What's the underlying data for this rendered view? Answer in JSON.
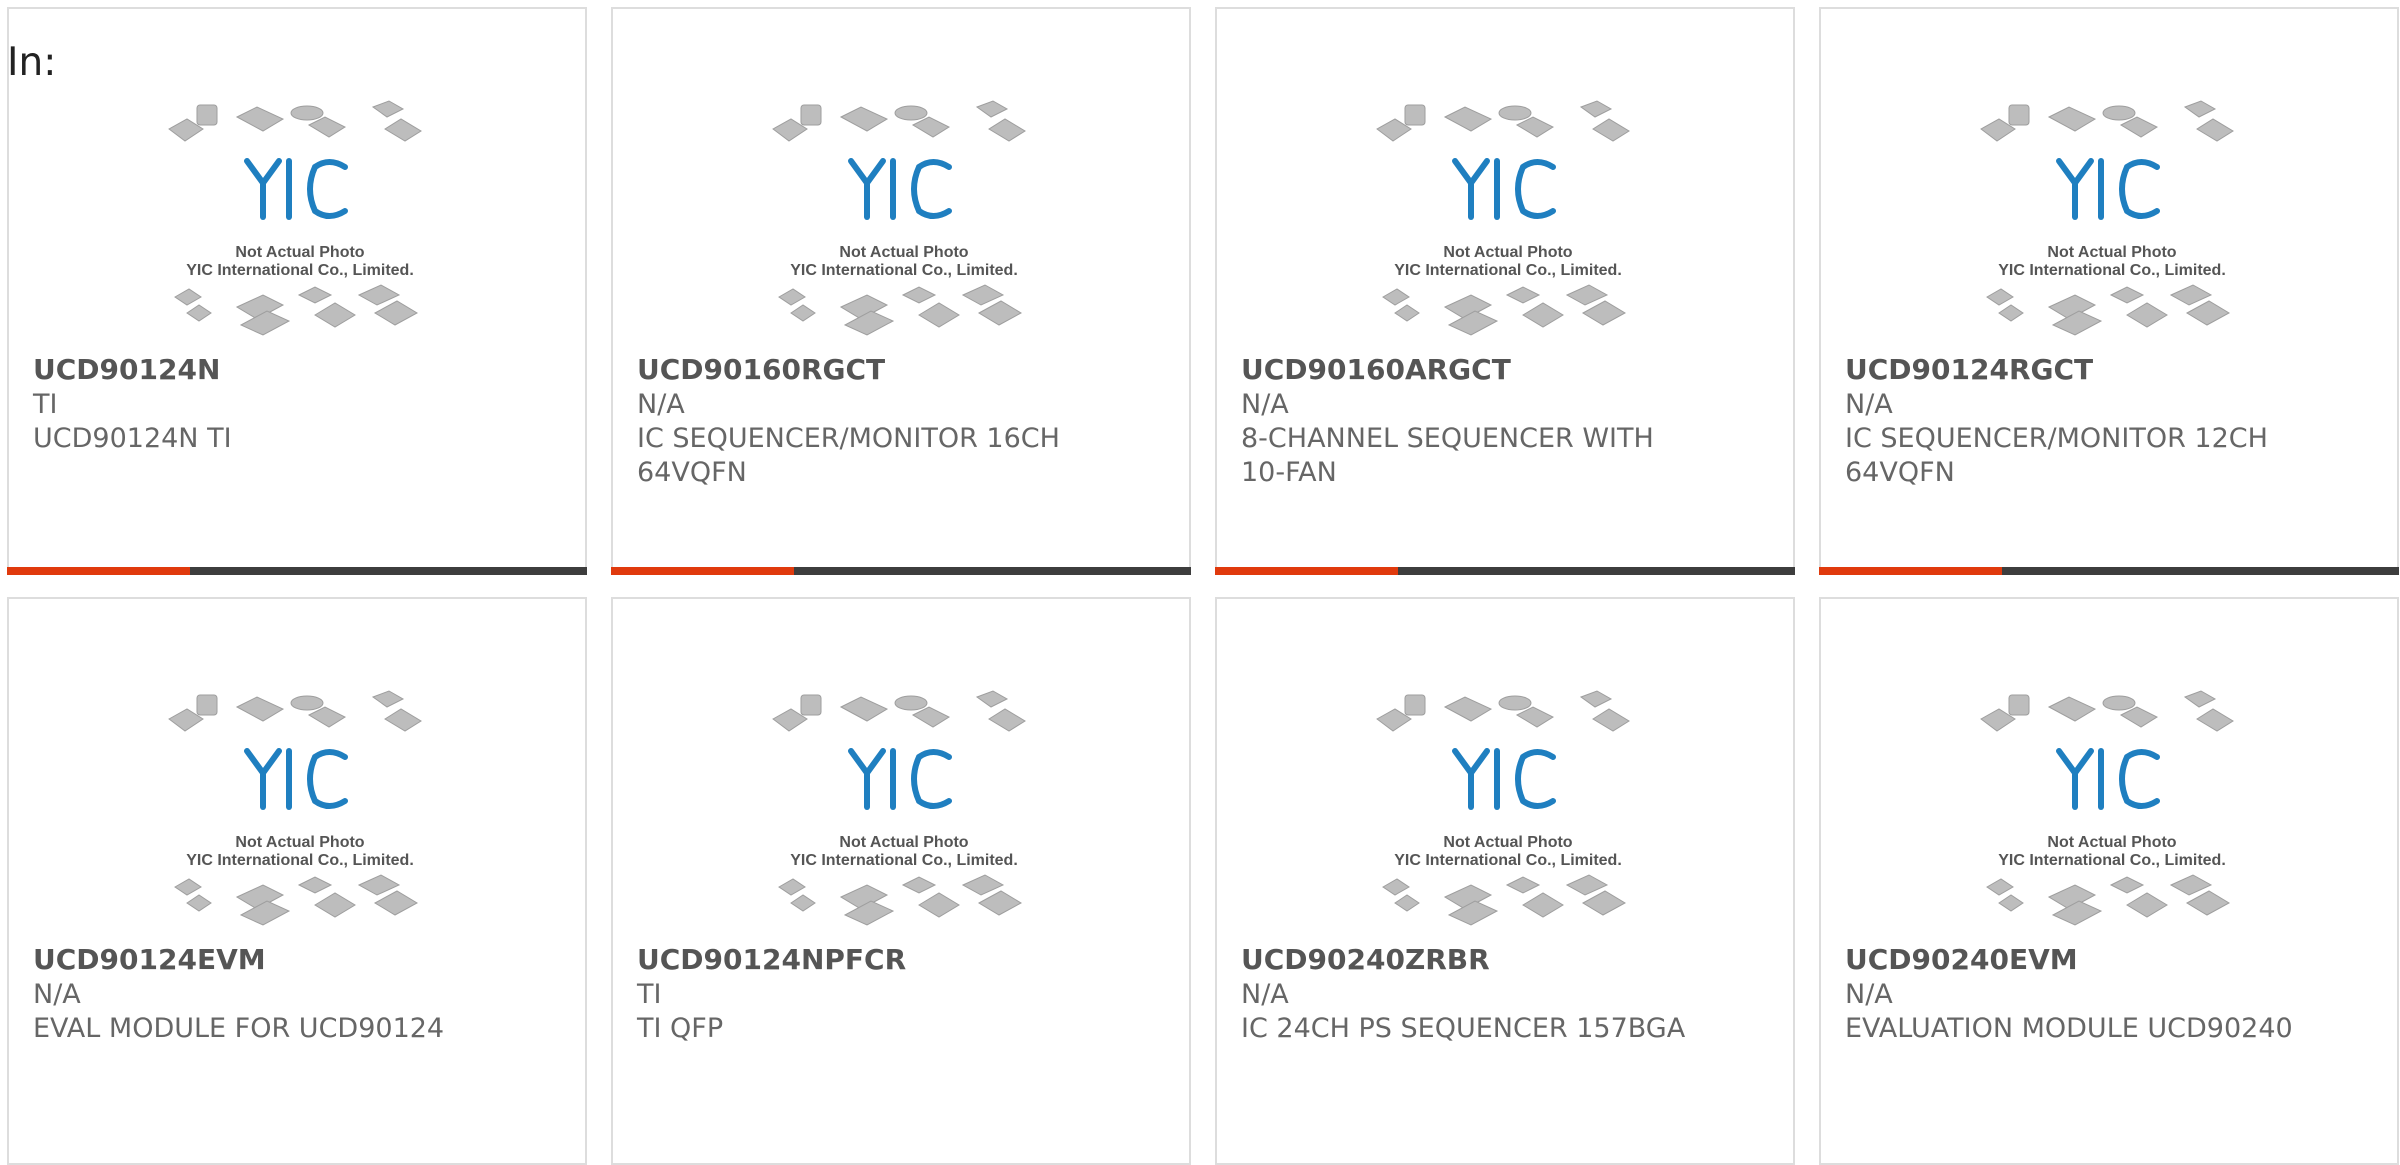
{
  "heading": "In:",
  "colors": {
    "accent": "#e03a0d",
    "bar": "#3d3d3d",
    "logo_blue": "#1f7fc0"
  },
  "photo": {
    "icon": "ic-chip-package-icon",
    "logo": "YIC",
    "caption_line1": "Not Actual Photo",
    "caption_line2": "YIC International Co., Limited."
  },
  "products": [
    {
      "part": "UCD90124N",
      "mfr": "TI",
      "desc": "UCD90124N TI",
      "has_bar": true
    },
    {
      "part": "UCD90160RGCT",
      "mfr": "N/A",
      "desc": "IC SEQUENCER/MONITOR 16CH 64VQFN",
      "has_bar": true
    },
    {
      "part": "UCD90160ARGCT",
      "mfr": "N/A",
      "desc": "8-CHANNEL SEQUENCER WITH 10-FAN",
      "has_bar": true
    },
    {
      "part": "UCD90124RGCT",
      "mfr": "N/A",
      "desc": "IC SEQUENCER/MONITOR 12CH 64VQFN",
      "has_bar": true
    },
    {
      "part": "UCD90124EVM",
      "mfr": "N/A",
      "desc": "EVAL MODULE FOR UCD90124",
      "has_bar": false
    },
    {
      "part": "UCD90124NPFCR",
      "mfr": "TI",
      "desc": "TI QFP",
      "has_bar": false
    },
    {
      "part": "UCD90240ZRBR",
      "mfr": "N/A",
      "desc": "IC 24CH PS SEQUENCER 157BGA",
      "has_bar": false
    },
    {
      "part": "UCD90240EVM",
      "mfr": "N/A",
      "desc": "EVALUATION MODULE UCD90240",
      "has_bar": false
    }
  ]
}
